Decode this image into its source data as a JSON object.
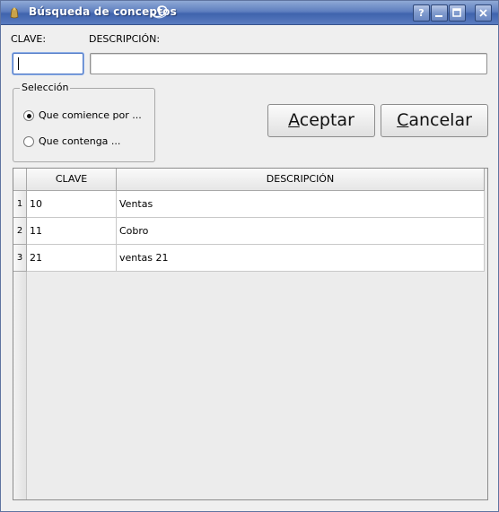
{
  "window": {
    "title": "Búsqueda de conceptos",
    "buttons": {
      "help": "?",
      "minimize": "_",
      "maximize": "□",
      "close": "×"
    }
  },
  "fields": {
    "clave_label": "CLAVE:",
    "descripcion_label": "DESCRIPCIÓN:",
    "clave_value": "",
    "descripcion_value": ""
  },
  "selection": {
    "title": "Selección",
    "options": [
      {
        "label": "Que comience por ...",
        "selected": true
      },
      {
        "label": "Que contenga ...",
        "selected": false
      }
    ]
  },
  "actions": {
    "accept_mnemonic": "A",
    "accept_rest": "ceptar",
    "cancel_mnemonic": "C",
    "cancel_rest": "ancelar"
  },
  "table": {
    "columns": [
      "CLAVE",
      "DESCRIPCIÓN"
    ],
    "rows": [
      {
        "num": "1",
        "clave": "10",
        "descripcion": "Ventas"
      },
      {
        "num": "2",
        "clave": "11",
        "descripcion": "Cobro"
      },
      {
        "num": "3",
        "clave": "21",
        "descripcion": "ventas 21"
      }
    ]
  },
  "icons": {
    "app": "app-icon",
    "swirl": "kde-swirl-icon"
  },
  "colors": {
    "titlebar": "#5f7fbf",
    "focus": "#4f78c5",
    "background": "#efefef"
  }
}
